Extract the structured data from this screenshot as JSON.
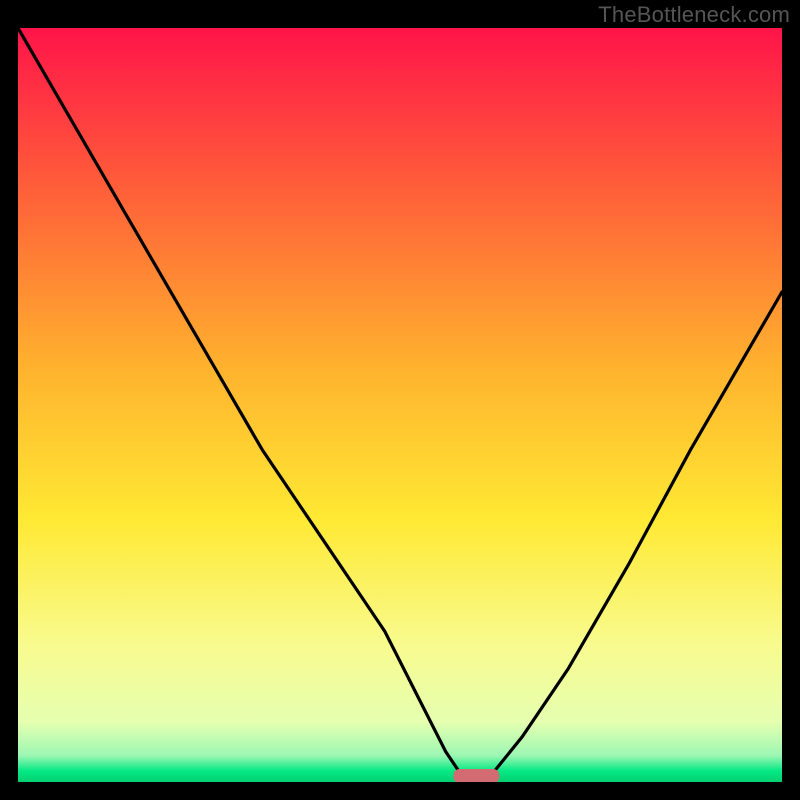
{
  "watermark": "TheBottleneck.com",
  "chart_data": {
    "type": "line",
    "title": "",
    "xlabel": "",
    "ylabel": "",
    "xlim": [
      0,
      100
    ],
    "ylim": [
      0,
      100
    ],
    "grid": false,
    "legend": false,
    "annotations": [],
    "series": [
      {
        "name": "bottleneck-curve",
        "x": [
          0,
          8,
          16,
          24,
          32,
          40,
          48,
          53,
          56,
          58,
          60,
          62,
          66,
          72,
          80,
          88,
          96,
          100
        ],
        "y": [
          100,
          86,
          72,
          58,
          44,
          32,
          20,
          10,
          4,
          1,
          0,
          1,
          6,
          15,
          29,
          44,
          58,
          65
        ]
      }
    ],
    "marker": {
      "x_center": 60,
      "width": 6,
      "color": "#d36b73"
    },
    "gradient_stops": [
      {
        "offset": 0.0,
        "color": "#ff1449"
      },
      {
        "offset": 0.2,
        "color": "#ff5a3a"
      },
      {
        "offset": 0.45,
        "color": "#ffb22e"
      },
      {
        "offset": 0.65,
        "color": "#ffe933"
      },
      {
        "offset": 0.82,
        "color": "#f8fb8f"
      },
      {
        "offset": 0.92,
        "color": "#e6ffb0"
      },
      {
        "offset": 0.965,
        "color": "#9cf7b3"
      },
      {
        "offset": 0.985,
        "color": "#06e984"
      },
      {
        "offset": 1.0,
        "color": "#00d173"
      }
    ]
  }
}
